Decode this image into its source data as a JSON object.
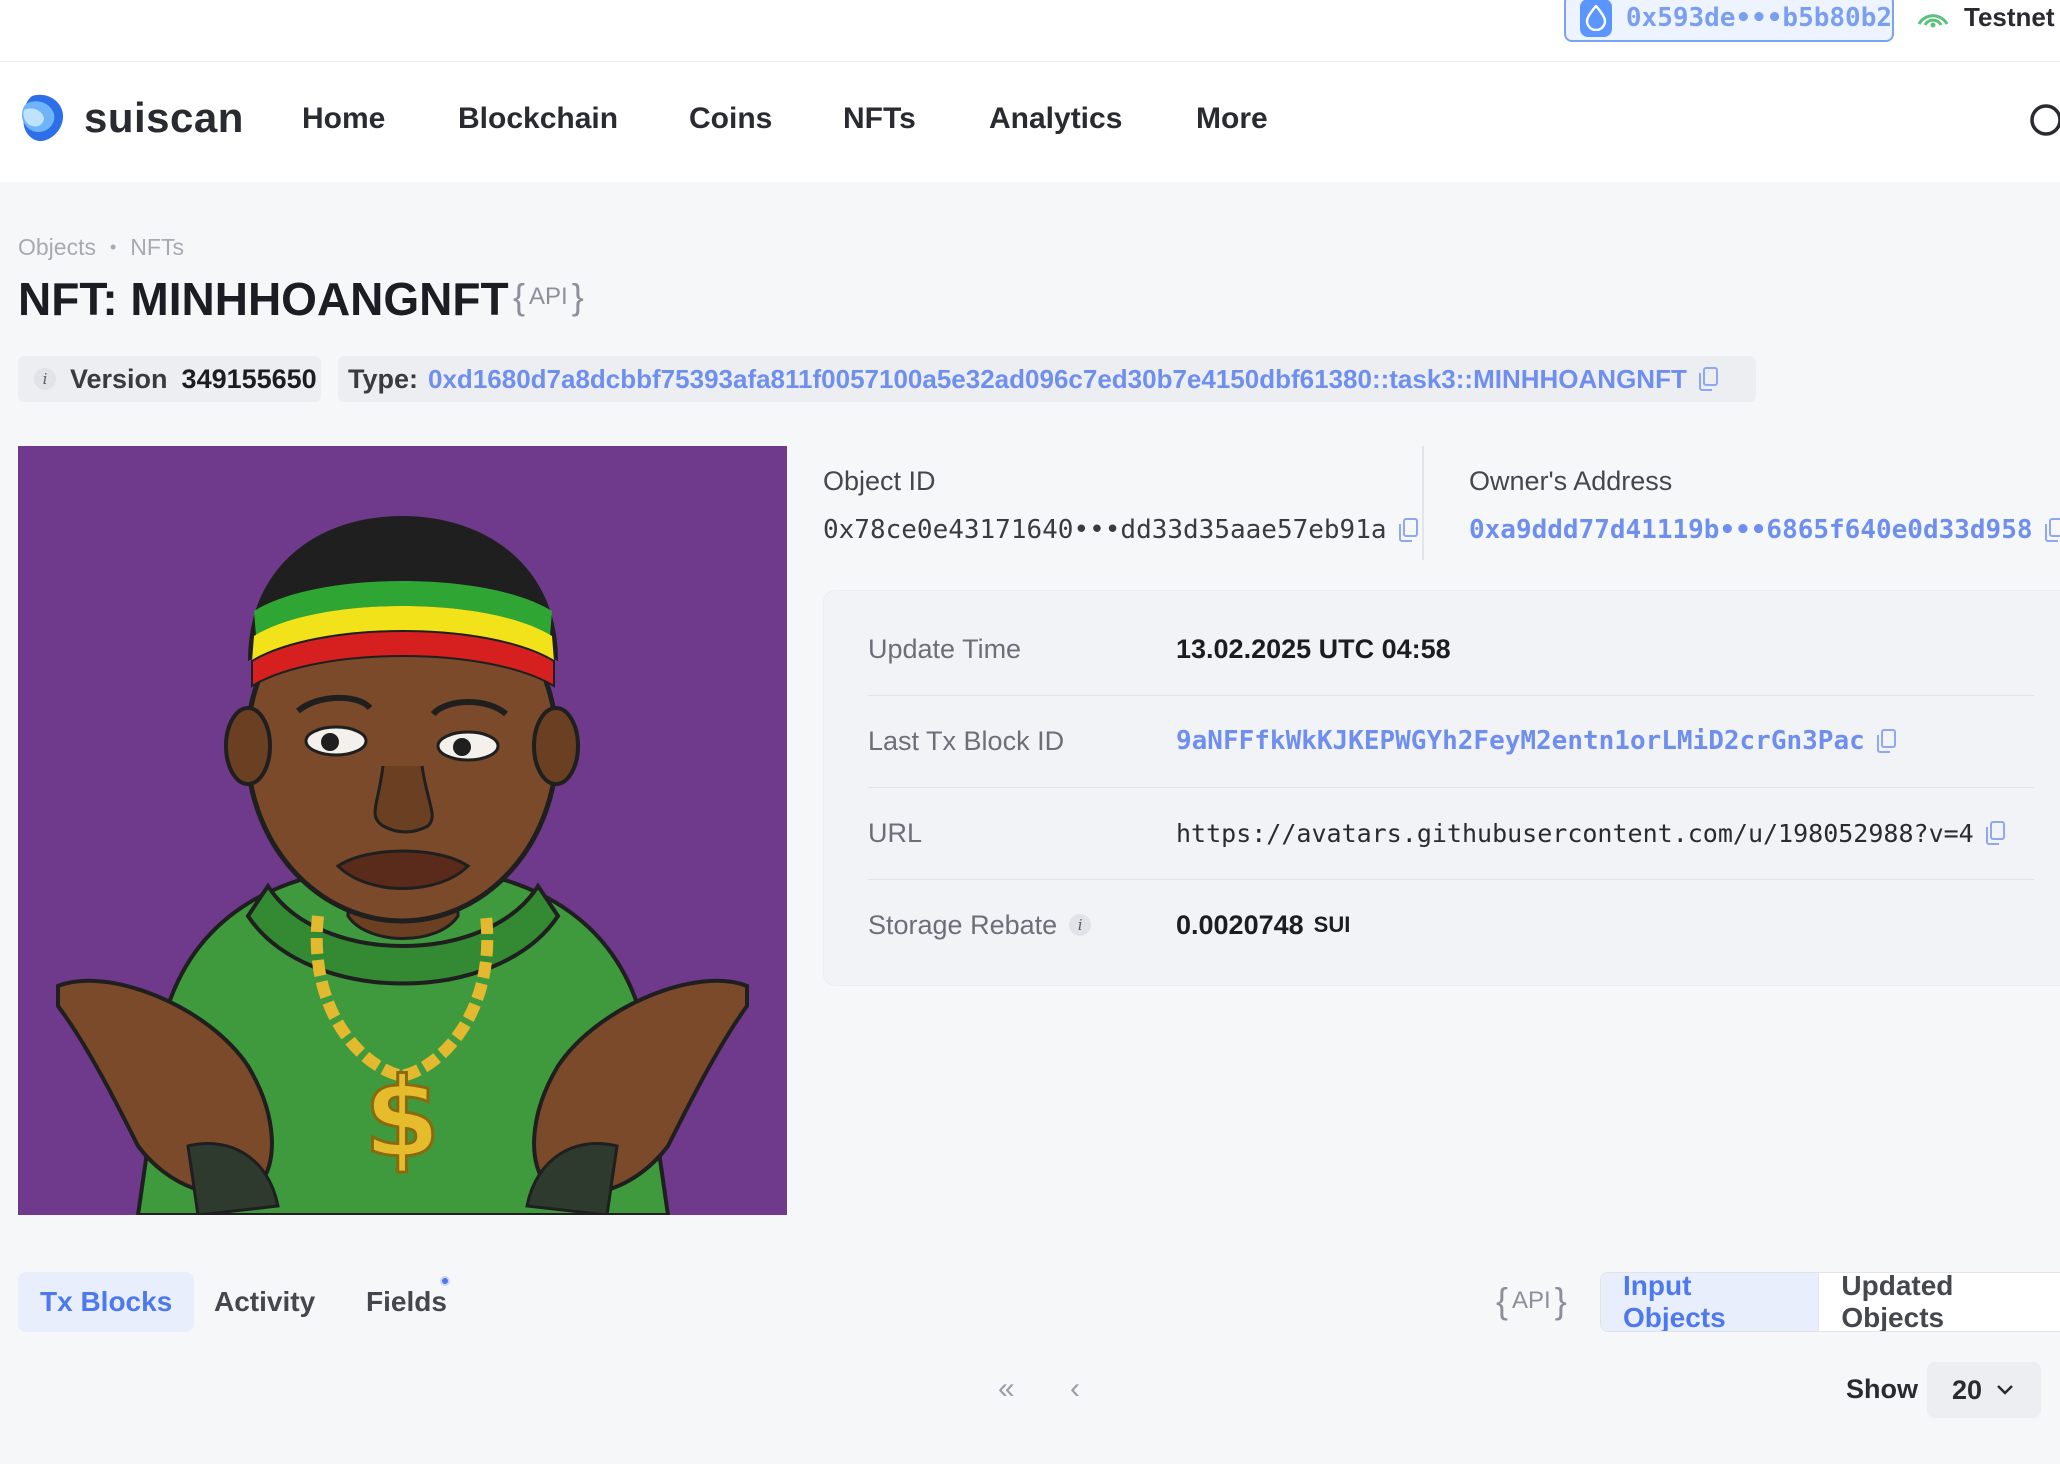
{
  "wallet": {
    "address": "0x593de•••b5b80b2",
    "network": "Testnet"
  },
  "brand": {
    "name": "suiscan"
  },
  "nav": [
    "Home",
    "Blockchain",
    "Coins",
    "NFTs",
    "Analytics",
    "More"
  ],
  "breadcrumb": [
    "Objects",
    "NFTs"
  ],
  "page": {
    "title": "NFT: MINHHOANGNFT",
    "api_label": "API"
  },
  "version": {
    "label": "Version",
    "value": "349155650"
  },
  "type": {
    "label": "Type:",
    "value": "0xd1680d7a8dcbbf75393afa811f0057100a5e32ad096c7ed30b7e4150dbf61380::task3::MINHHOANGNFT"
  },
  "object_id": {
    "label": "Object ID",
    "value": "0x78ce0e43171640•••dd33d35aae57eb91a"
  },
  "owner": {
    "label": "Owner's Address",
    "value": "0xa9ddd77d41119b•••6865f640e0d33d958"
  },
  "details": {
    "update_time": {
      "label": "Update Time",
      "value": "13.02.2025 UTC 04:58"
    },
    "last_tx": {
      "label": "Last Tx Block ID",
      "value": "9aNFFfkWkKJKEPWGYh2FeyM2entn1orLMiD2crGn3Pac"
    },
    "url": {
      "label": "URL",
      "value": "https://avatars.githubusercontent.com/u/198052988?v=4"
    },
    "storage_rebate": {
      "label": "Storage Rebate",
      "value": "0.0020748",
      "unit": "SUI"
    }
  },
  "tabs": [
    "Tx Blocks",
    "Activity",
    "Fields"
  ],
  "segments": [
    "Input Objects",
    "Updated Objects"
  ],
  "pagination": {
    "first": "«",
    "prev": "‹",
    "show_label": "Show",
    "page_size": "20"
  },
  "colors": {
    "accent": "#4e79ee",
    "link": "#6f8ff0",
    "nft_bg": "#6f3a8c"
  }
}
